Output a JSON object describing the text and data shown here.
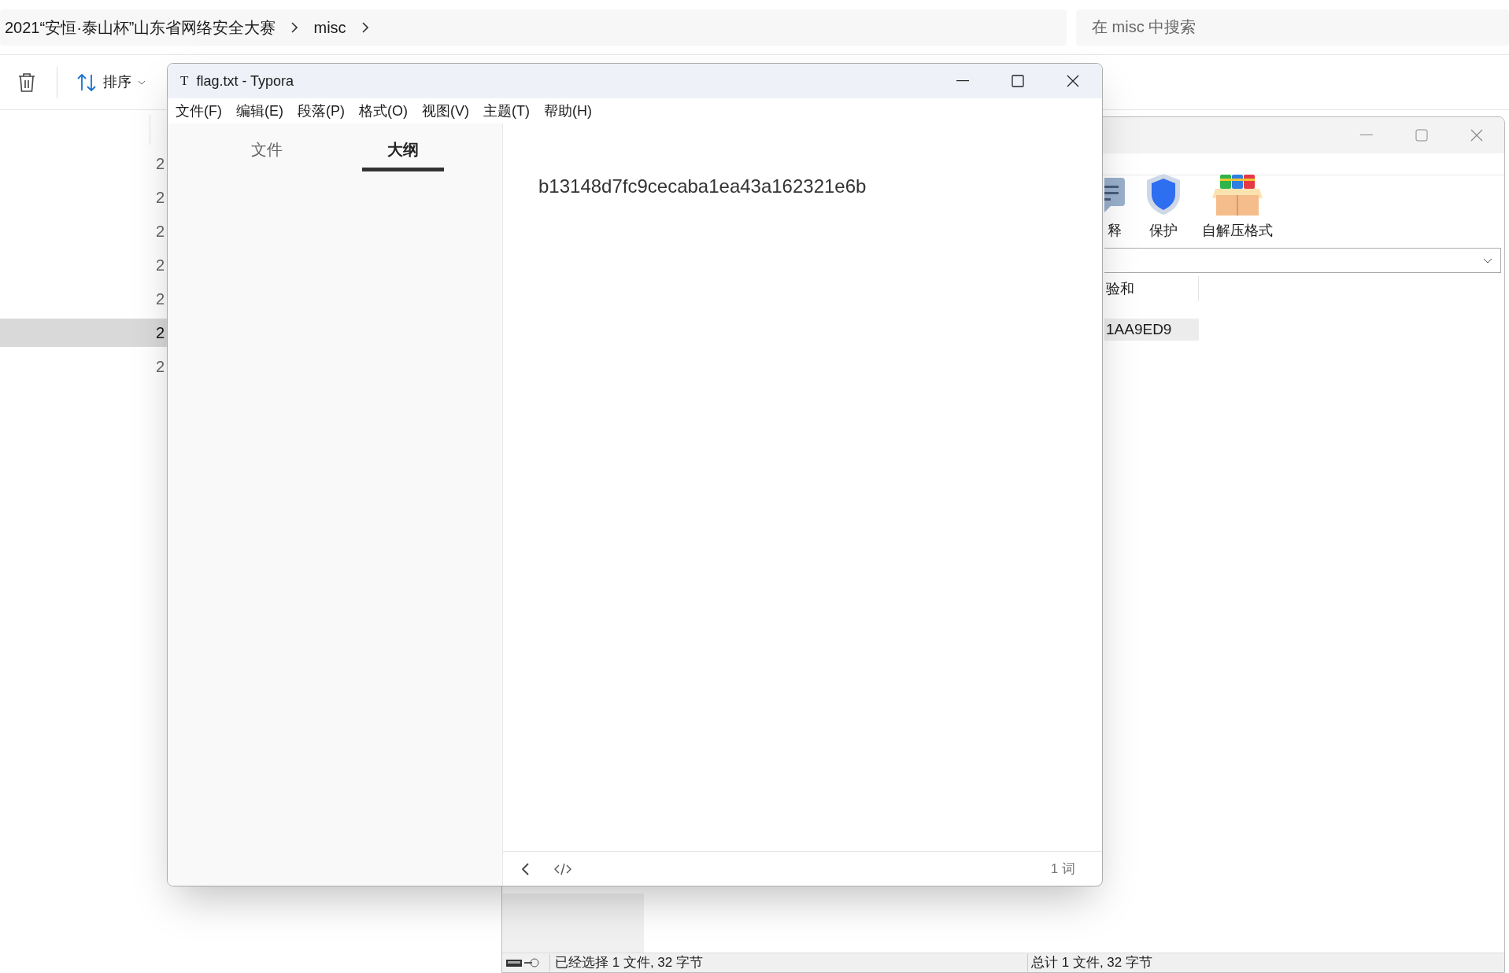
{
  "explorer": {
    "breadcrumb": [
      "2021“安恒·泰山杯”山东省网络安全大赛",
      "misc"
    ],
    "search": {
      "placeholder": "在 misc 中搜索"
    },
    "sort_label": "排序",
    "rows": [
      {
        "text": "2",
        "selected": false
      },
      {
        "text": "2",
        "selected": false
      },
      {
        "text": "2",
        "selected": false
      },
      {
        "text": "2",
        "selected": false
      },
      {
        "text": "2",
        "selected": false
      },
      {
        "text": "2",
        "selected": true
      },
      {
        "text": "2",
        "selected": false
      }
    ]
  },
  "archiver": {
    "tools": [
      {
        "kind": "comment",
        "label": "释"
      },
      {
        "kind": "shield",
        "label": "保护"
      },
      {
        "kind": "box",
        "label": "自解压格式"
      }
    ],
    "column_header": "验和",
    "rows": [
      {
        "text": "1AA9ED9",
        "selected": true
      }
    ],
    "status_left": "已经选择 1 文件, 32 字节",
    "status_right": "总计 1 文件, 32 字节"
  },
  "editor": {
    "icon_letter": "T",
    "title": "flag.txt - Typora",
    "menu": [
      "文件(F)",
      "编辑(E)",
      "段落(P)",
      "格式(O)",
      "视图(V)",
      "主题(T)",
      "帮助(H)"
    ],
    "tabs": [
      {
        "label": "文件",
        "selected": false
      },
      {
        "label": "大纲",
        "selected": true
      }
    ],
    "content": "b13148d7fc9cecaba1ea43a162321e6b",
    "word_count": "1 词"
  }
}
